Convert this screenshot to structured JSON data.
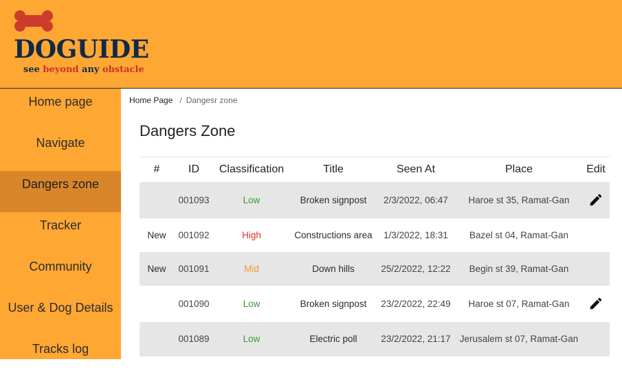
{
  "brand": {
    "name": "DOGUIDE",
    "tagline_parts": [
      "see ",
      "beyond",
      " any ",
      "obstacle"
    ]
  },
  "sidebar": {
    "items": [
      {
        "label": "Home page"
      },
      {
        "label": "Navigate"
      },
      {
        "label": "Dangers zone",
        "active": true
      },
      {
        "label": "Tracker"
      },
      {
        "label": "Community"
      },
      {
        "label": "User & Dog Details"
      },
      {
        "label": "Tracks log"
      }
    ]
  },
  "breadcrumb": {
    "home": "Home Page",
    "separator": "/",
    "current": "Dangesr zone"
  },
  "page": {
    "title": "Dangers Zone"
  },
  "table": {
    "headers": [
      "#",
      "ID",
      "Classification",
      "Title",
      "Seen At",
      "Place",
      "Edit"
    ],
    "rows": [
      {
        "tag": "",
        "id": "001093",
        "classification": "Low",
        "title": "Broken signpost",
        "seen_at": "2/3/2022, 06:47",
        "place": "Haroe st 35, Ramat-Gan",
        "editable": true
      },
      {
        "tag": "New",
        "id": "001092",
        "classification": "High",
        "title": "Constructions area",
        "seen_at": "1/3/2022, 18:31",
        "place": "Bazel st 04, Ramat-Gan",
        "editable": false
      },
      {
        "tag": "New",
        "id": "001091",
        "classification": "Mid",
        "title": "Down hills",
        "seen_at": "25/2/2022, 12:22",
        "place": "Begin st 39, Ramat-Gan",
        "editable": false
      },
      {
        "tag": "",
        "id": "001090",
        "classification": "Low",
        "title": "Broken signpost",
        "seen_at": "23/2/2022, 22:49",
        "place": "Haroe st 07, Ramat-Gan",
        "editable": true
      },
      {
        "tag": "",
        "id": "001089",
        "classification": "Low",
        "title": "Electric poll",
        "seen_at": "23/2/2022, 21:17",
        "place": "Jerusalem st 07, Ramat-Gan",
        "editable": false
      }
    ]
  },
  "colors": {
    "brand_orange": "#ffa733",
    "active_nav": "#d9862b",
    "low": "#3a9a3a",
    "high": "#e0312d",
    "mid": "#f39a2c"
  },
  "icons": {
    "logo": "bone-icon",
    "edit": "pencil-icon"
  }
}
